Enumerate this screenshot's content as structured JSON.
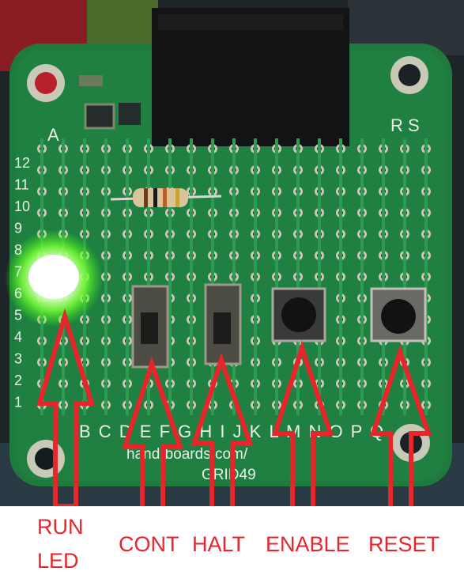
{
  "board": {
    "columns_top_left": "A",
    "columns_top_right": "R S",
    "row_numbers": [
      "12",
      "11",
      "10",
      "9",
      "8",
      "7",
      "6",
      "5",
      "4",
      "3",
      "2",
      "1"
    ],
    "column_letters": "B C D E F G H I J K L M N O P Q",
    "footer_line1": "hand-boards.com/",
    "footer_line2": "GRID49"
  },
  "labels": {
    "run": "RUN",
    "led": "LED",
    "cont": "CONT",
    "halt": "HALT",
    "enable": "ENABLE",
    "reset": "RESET"
  },
  "colors": {
    "pcb": "#1f7a3e",
    "pcb_dark": "#145a2c",
    "annotation": "#e8252a",
    "led_glow": "#b9ff6a"
  }
}
